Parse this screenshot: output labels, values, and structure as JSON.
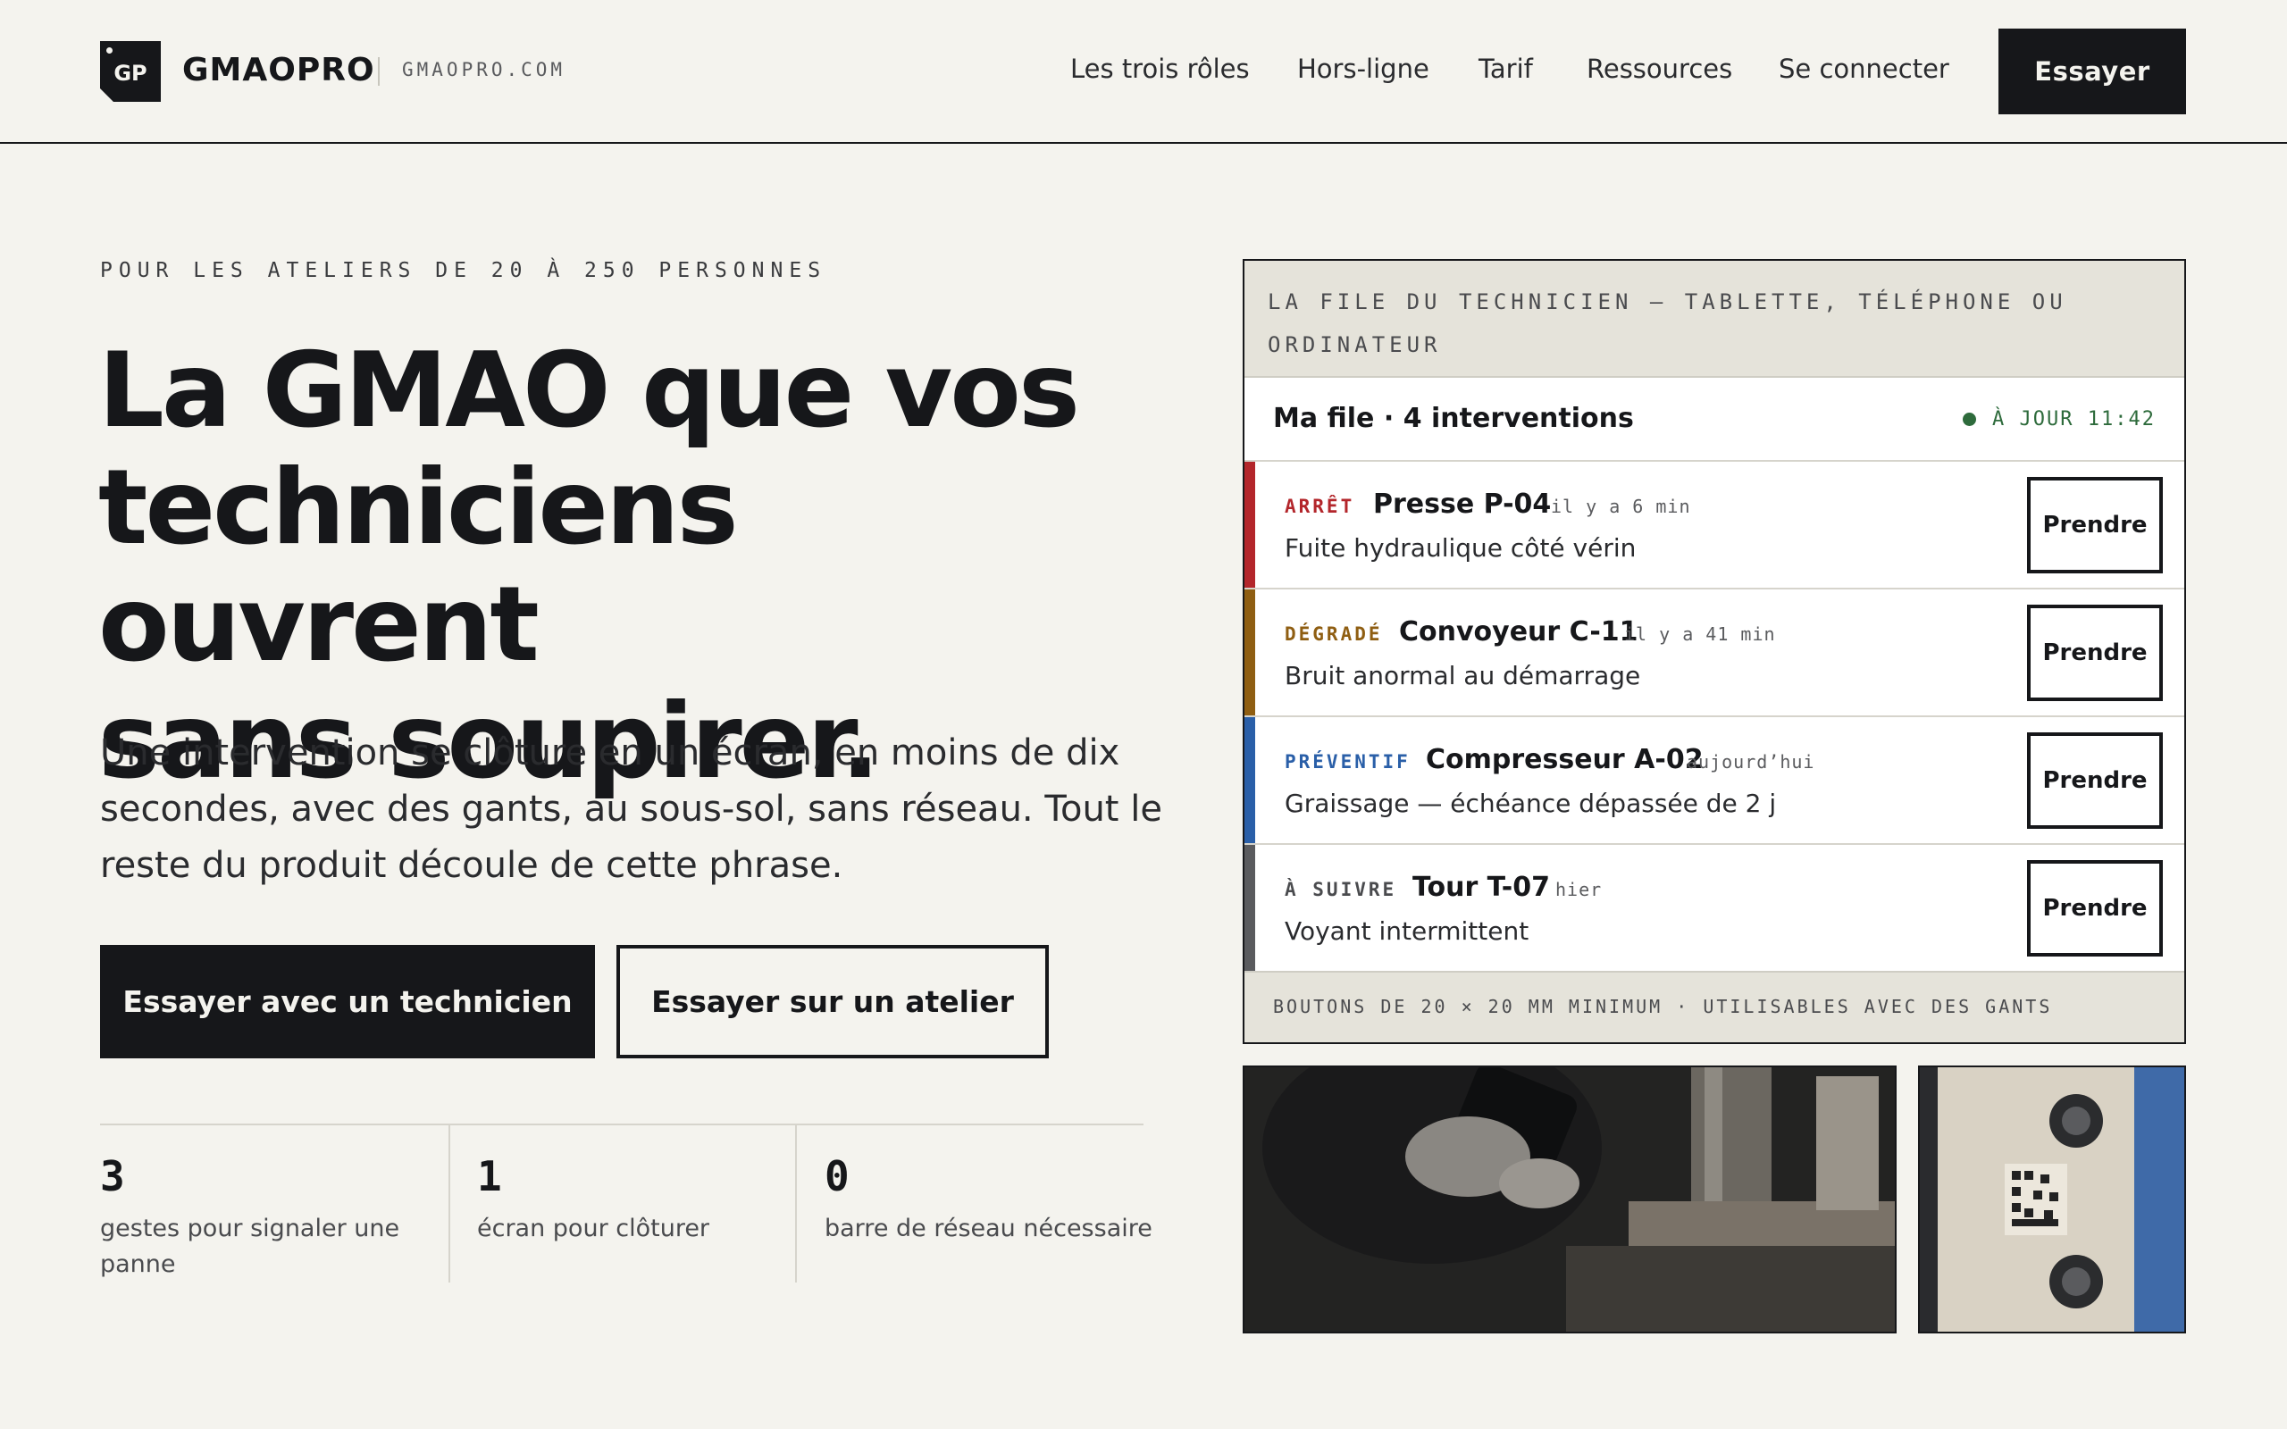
{
  "header": {
    "logo_text": "GP",
    "brand": "GMAOPRO",
    "domain": "GMAOPRO.COM",
    "nav": [
      "Les trois rôles",
      "Hors-ligne",
      "Tarif",
      "Ressources",
      "Se connecter"
    ],
    "cta": "Essayer"
  },
  "hero": {
    "eyebrow": "POUR LES ATELIERS DE 20 À 250 PERSONNES",
    "title_lines": [
      "La GMAO que vos",
      "techniciens ouvrent",
      "sans soupirer."
    ],
    "subtitle": "Une intervention se clôture en un écran, en moins de dix secondes, avec des gants, au sous-sol, sans réseau. Tout le reste du produit découle de cette phrase.",
    "primary_button": "Essayer avec un technicien",
    "secondary_button": "Essayer sur un atelier",
    "stats": [
      {
        "value": "3",
        "label": "gestes pour signaler une panne"
      },
      {
        "value": "1",
        "label": "écran pour clôturer"
      },
      {
        "value": "0",
        "label": "barre de réseau nécessaire"
      }
    ]
  },
  "queue": {
    "header": "LA FILE DU TECHNICIEN — TABLETTE, TÉLÉPHONE OU ORDINATEUR",
    "title": "Ma file · 4 interventions",
    "sync_status": "À JOUR 11:42",
    "sync_color": "#2e6b3c",
    "jobs": [
      {
        "tag": "ARRÊT",
        "name": "Presse P-04",
        "when": "il y a 6 min",
        "desc": "Fuite hydraulique côté vérin",
        "color": "#b3262b",
        "action": "Prendre"
      },
      {
        "tag": "DÉGRADÉ",
        "name": "Convoyeur C-11",
        "when": "il y a 41 min",
        "desc": "Bruit anormal au démarrage",
        "color": "#8f5e12",
        "action": "Prendre"
      },
      {
        "tag": "PRÉVENTIF",
        "name": "Compresseur A-02",
        "when": "aujourd’hui",
        "desc": "Graissage — échéance dépassée de 2 j",
        "color": "#2a5fa8",
        "action": "Prendre"
      },
      {
        "tag": "À SUIVRE",
        "name": "Tour T-07",
        "when": "hier",
        "desc": "Voyant intermittent",
        "color": "#5a5b5e",
        "action": "Prendre"
      }
    ],
    "footer": "BOUTONS DE 20 × 20 MM MINIMUM · UTILISABLES AVEC DES GANTS"
  },
  "colors": {
    "background": "#f4f3ee",
    "ink": "#16171a",
    "panel_band": "#e5e3da"
  }
}
